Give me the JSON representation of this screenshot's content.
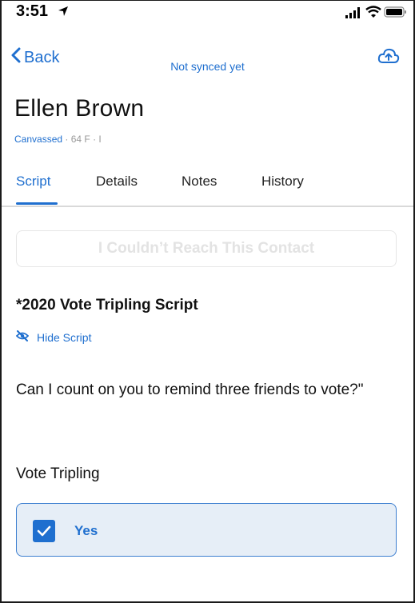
{
  "status_bar": {
    "time": "3:51",
    "icons": [
      "location-arrow-icon",
      "signal-icon",
      "wifi-icon",
      "battery-icon"
    ]
  },
  "nav": {
    "back_label": "Back",
    "sync_status": "Not synced yet",
    "upload_icon": "cloud-upload-icon"
  },
  "contact": {
    "name": "Ellen Brown",
    "status": "Canvassed",
    "details": "· 64  F · I"
  },
  "tabs": [
    {
      "label": "Script",
      "active": true
    },
    {
      "label": "Details",
      "active": false
    },
    {
      "label": "Notes",
      "active": false
    },
    {
      "label": "History",
      "active": false
    }
  ],
  "reach_button_label": "I Couldn’t Reach This Contact",
  "script": {
    "title": "*2020 Vote Tripling Script",
    "hide_label": "Hide Script",
    "hide_icon": "eye-slash-icon",
    "text": "Can I count on you to remind three friends to vote?\""
  },
  "question": {
    "label": "Vote Tripling",
    "answer": {
      "label": "Yes",
      "checked": true
    }
  },
  "colors": {
    "accent": "#1f6fcf",
    "card_bg": "#e6eef7",
    "divider": "#d9d9d9"
  }
}
